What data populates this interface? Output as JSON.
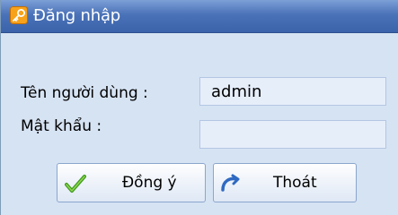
{
  "window": {
    "title": "Đăng nhập",
    "icon": "key-icon"
  },
  "form": {
    "username_label": "Tên người dùng :",
    "username_value": "admin",
    "password_label": "Mật khẩu :",
    "password_value": ""
  },
  "buttons": {
    "ok_label": "Đồng ý",
    "ok_icon": "checkmark-icon",
    "exit_label": "Thoát",
    "exit_icon": "exit-arrow-icon"
  },
  "colors": {
    "titlebar": "#4a72b8",
    "dialog_bg": "#d6e3f3",
    "field_bg": "#e6eefa"
  }
}
